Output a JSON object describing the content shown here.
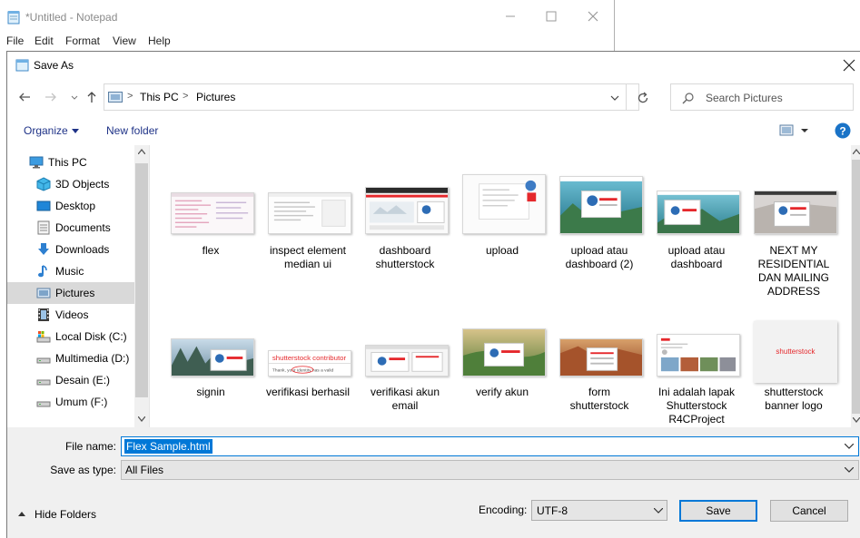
{
  "notepad": {
    "title": "*Untitled - Notepad",
    "menu": [
      "File",
      "Edit",
      "Format",
      "View",
      "Help"
    ]
  },
  "dialog": {
    "title": "Save As",
    "breadcrumb": [
      "This PC",
      "Pictures"
    ],
    "search_placeholder": "Search Pictures",
    "toolbar": {
      "organize": "Organize",
      "new_folder": "New folder",
      "help": "?"
    },
    "sidebar": [
      {
        "label": "This PC",
        "icon": "computer-icon"
      },
      {
        "label": "3D Objects",
        "icon": "cube-icon"
      },
      {
        "label": "Desktop",
        "icon": "desktop-icon"
      },
      {
        "label": "Documents",
        "icon": "documents-icon"
      },
      {
        "label": "Downloads",
        "icon": "download-icon"
      },
      {
        "label": "Music",
        "icon": "music-icon"
      },
      {
        "label": "Pictures",
        "icon": "pictures-icon",
        "selected": true
      },
      {
        "label": "Videos",
        "icon": "video-icon"
      },
      {
        "label": "Local Disk (C:)",
        "icon": "system-drive-icon"
      },
      {
        "label": "Multimedia (D:)",
        "icon": "drive-icon"
      },
      {
        "label": "Desain (E:)",
        "icon": "drive-icon"
      },
      {
        "label": "Umum (F:)",
        "icon": "drive-icon"
      }
    ],
    "files": [
      {
        "name": "flex",
        "lines": [
          "flex"
        ]
      },
      {
        "name": "inspect element median ui",
        "lines": [
          "inspect element",
          "median ui"
        ]
      },
      {
        "name": "dashboard shutterstock",
        "lines": [
          "dashboard",
          "shutterstock"
        ]
      },
      {
        "name": "upload",
        "lines": [
          "upload"
        ]
      },
      {
        "name": "upload atau dashboard (2)",
        "lines": [
          "upload atau",
          "dashboard (2)"
        ]
      },
      {
        "name": "upload atau dashboard",
        "lines": [
          "upload atau",
          "dashboard"
        ]
      },
      {
        "name": "NEXT MY RESIDENTIAL DAN MAILING ADDRESS",
        "lines": [
          "NEXT MY",
          "RESIDENTIAL",
          "DAN MAILING",
          "ADDRESS"
        ]
      },
      {
        "name": "signin",
        "lines": [
          "signin"
        ]
      },
      {
        "name": "verifikasi berhasil",
        "lines": [
          "verifikasi berhasil"
        ]
      },
      {
        "name": "verifikasi akun email",
        "lines": [
          "verifikasi akun",
          "email"
        ]
      },
      {
        "name": "verify akun",
        "lines": [
          "verify akun"
        ]
      },
      {
        "name": "form shutterstock",
        "lines": [
          "form",
          "shutterstock"
        ]
      },
      {
        "name": "Ini adalah lapak Shutterstock R4CProject",
        "lines": [
          "Ini adalah lapak",
          "Shutterstock",
          "R4CProject"
        ]
      },
      {
        "name": "shutterstock banner logo",
        "lines": [
          "shutterstock",
          "banner logo"
        ]
      }
    ],
    "thumb_text": {
      "shutterstock_logo": "shutterstock",
      "contributor_logo": "shutterstock contributor",
      "contributor_msg": "Thank, your identity has a valid"
    },
    "file_name_label": "File name:",
    "file_name_value": "Flex Sample.html",
    "save_as_type_label": "Save as type:",
    "save_as_type_value": "All Files",
    "hide_folders": "Hide Folders",
    "encoding_label": "Encoding:",
    "encoding_value": "UTF-8",
    "save_button": "Save",
    "cancel_button": "Cancel"
  },
  "colors": {
    "accent": "#0078d7",
    "link_text": "#1e3287",
    "selected_nav": "#d9d9d9",
    "shutterstock_red": "#e5282c"
  }
}
